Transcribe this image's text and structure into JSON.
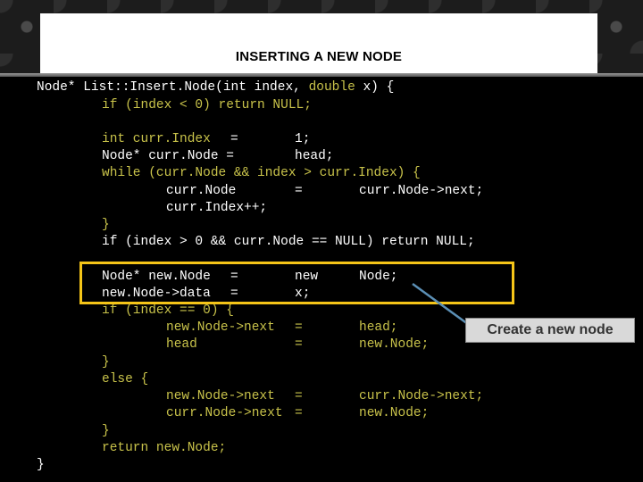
{
  "slide": {
    "title": "INSERTING A NEW NODE"
  },
  "code": {
    "l1a": "Node* List::Insert.Node(int index, ",
    "l1b": "double",
    "l1c": " x) {",
    "l2": "if (index < 0) return NULL;",
    "l3a": "int curr.Index",
    "l3b": "=",
    "l3c": "1;",
    "l4a": "Node* curr.Node =",
    "l4b": "head;",
    "l5": "while (curr.Node && index > curr.Index) {",
    "l6a": "curr.Node",
    "l6b": "=",
    "l6c": "curr.Node->next;",
    "l7": "curr.Index++;",
    "l8": "}",
    "l9": "if (index > 0 && curr.Node == NULL) return NULL;",
    "l10a": "Node* new.Node",
    "l10b": "=",
    "l10c": "new",
    "l10d": "Node;",
    "l11a": "new.Node->data",
    "l11b": "=",
    "l11c": "x;",
    "l12": "if (index == 0) {",
    "l13a": "new.Node->next",
    "l13b": "=",
    "l13c": "head;",
    "l14a": "head",
    "l14b": "=",
    "l14c": "new.Node;",
    "l15": "}",
    "l16": "else {",
    "l17a": "new.Node->next",
    "l17b": "=",
    "l17c": "curr.Node->next;",
    "l18a": "curr.Node->next",
    "l18b": "=",
    "l18c": "new.Node;",
    "l19": "}",
    "l20": "return new.Node;",
    "l21": "}"
  },
  "callout": {
    "label": "Create a new node"
  },
  "colors": {
    "highlight": "#f5c518",
    "keyword": "#c8c24a",
    "pointer": "#5b8fb5"
  }
}
